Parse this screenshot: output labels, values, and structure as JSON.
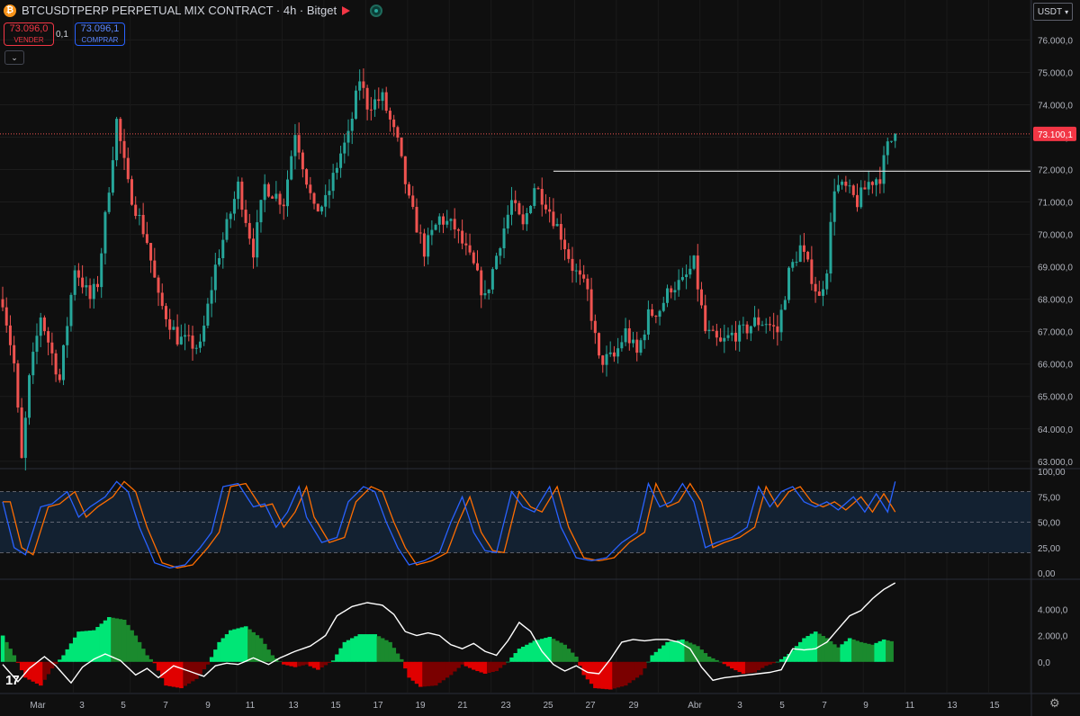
{
  "header": {
    "symbol_title": "BTCUSDTPERP PERPETUAL MIX CONTRACT · 4h · Bitget",
    "sell_price": "73.096,0",
    "sell_label": "VENDER",
    "spread": "0,1",
    "buy_price": "73.096,1",
    "buy_label": "COMPRAR",
    "currency": "USDT"
  },
  "icons": {
    "coin": "bitcoin-icon",
    "flag": "flag-icon",
    "status": "market-open-icon",
    "settings": "gear-icon"
  },
  "colors": {
    "up": "#26a69a",
    "down": "#ef5350",
    "bg": "#0f0f0f",
    "stoch_k": "#2962ff",
    "stoch_d": "#ff6d00"
  },
  "chart_data": [
    {
      "type": "candlestick",
      "price_axis": [
        "76.000,0",
        "75.000,0",
        "74.000,0",
        "73.000,0",
        "72.000,0",
        "71.000,0",
        "70.000,0",
        "69.000,0",
        "68.000,0",
        "67.000,0",
        "66.000,0",
        "65.000,0",
        "64.000,0",
        "63.000,0"
      ],
      "ylim": [
        62800,
        76400
      ],
      "last_price": 73100.1,
      "last_price_label": "73.100,1",
      "horizontal_line": 71950,
      "x_labels": [
        "Mar",
        "3",
        "5",
        "7",
        "9",
        "11",
        "13",
        "15",
        "17",
        "19",
        "21",
        "23",
        "25",
        "27",
        "29",
        "Abr",
        "3",
        "5",
        "7",
        "9",
        "11",
        "13",
        "15"
      ],
      "anchors": [
        [
          0,
          68000
        ],
        [
          3,
          66000
        ],
        [
          5,
          63000
        ],
        [
          7,
          65500
        ],
        [
          10,
          67500
        ],
        [
          15,
          65500
        ],
        [
          19,
          69000
        ],
        [
          23,
          68000
        ],
        [
          25,
          68500
        ],
        [
          30,
          73500
        ],
        [
          33,
          71500
        ],
        [
          38,
          69800
        ],
        [
          41,
          68000
        ],
        [
          46,
          66800
        ],
        [
          52,
          66500
        ],
        [
          56,
          69000
        ],
        [
          62,
          71500
        ],
        [
          66,
          69500
        ],
        [
          69,
          71500
        ],
        [
          74,
          71000
        ],
        [
          77,
          73200
        ],
        [
          82,
          70700
        ],
        [
          85,
          71000
        ],
        [
          89,
          72500
        ],
        [
          91,
          73000
        ],
        [
          94,
          74800
        ],
        [
          96,
          74000
        ],
        [
          100,
          74200
        ],
        [
          104,
          72800
        ],
        [
          107,
          71000
        ],
        [
          111,
          69500
        ],
        [
          115,
          70500
        ],
        [
          119,
          70200
        ],
        [
          124,
          69000
        ],
        [
          127,
          68000
        ],
        [
          131,
          69800
        ],
        [
          134,
          71000
        ],
        [
          137,
          70200
        ],
        [
          140,
          71500
        ],
        [
          143,
          71000
        ],
        [
          147,
          70000
        ],
        [
          150,
          69000
        ],
        [
          154,
          68200
        ],
        [
          157,
          66100
        ],
        [
          161,
          66200
        ],
        [
          164,
          67000
        ],
        [
          167,
          66300
        ],
        [
          170,
          67500
        ],
        [
          173,
          67700
        ],
        [
          176,
          68400
        ],
        [
          179,
          68500
        ],
        [
          182,
          69100
        ],
        [
          185,
          67000
        ],
        [
          189,
          66600
        ],
        [
          192,
          66900
        ],
        [
          195,
          67000
        ],
        [
          198,
          67300
        ],
        [
          201,
          67300
        ],
        [
          204,
          67000
        ],
        [
          207,
          68800
        ],
        [
          210,
          69600
        ],
        [
          213,
          68700
        ],
        [
          215,
          68000
        ],
        [
          217,
          69000
        ],
        [
          219,
          71500
        ],
        [
          222,
          71400
        ],
        [
          225,
          71000
        ],
        [
          228,
          71600
        ],
        [
          231,
          71800
        ],
        [
          233,
          72700
        ],
        [
          235,
          73100
        ]
      ]
    },
    {
      "type": "line",
      "name": "stochastic",
      "axis": [
        "100,00",
        "75,00",
        "50,00",
        "25,00",
        "0,00"
      ],
      "band": [
        20,
        80
      ],
      "mid": 50,
      "k": [
        [
          0,
          70
        ],
        [
          3,
          25
        ],
        [
          6,
          18
        ],
        [
          10,
          65
        ],
        [
          13,
          68
        ],
        [
          17,
          80
        ],
        [
          20,
          55
        ],
        [
          23,
          65
        ],
        [
          27,
          75
        ],
        [
          30,
          90
        ],
        [
          33,
          80
        ],
        [
          36,
          45
        ],
        [
          40,
          10
        ],
        [
          44,
          5
        ],
        [
          48,
          8
        ],
        [
          52,
          25
        ],
        [
          55,
          40
        ],
        [
          58,
          85
        ],
        [
          62,
          88
        ],
        [
          66,
          65
        ],
        [
          69,
          68
        ],
        [
          72,
          45
        ],
        [
          75,
          60
        ],
        [
          78,
          85
        ],
        [
          80,
          55
        ],
        [
          84,
          30
        ],
        [
          88,
          35
        ],
        [
          91,
          70
        ],
        [
          95,
          85
        ],
        [
          98,
          80
        ],
        [
          101,
          50
        ],
        [
          104,
          25
        ],
        [
          107,
          8
        ],
        [
          111,
          12
        ],
        [
          115,
          20
        ],
        [
          118,
          50
        ],
        [
          121,
          75
        ],
        [
          124,
          40
        ],
        [
          127,
          22
        ],
        [
          130,
          20
        ],
        [
          134,
          80
        ],
        [
          137,
          65
        ],
        [
          140,
          60
        ],
        [
          144,
          85
        ],
        [
          147,
          45
        ],
        [
          151,
          15
        ],
        [
          155,
          12
        ],
        [
          159,
          15
        ],
        [
          163,
          30
        ],
        [
          167,
          40
        ],
        [
          170,
          88
        ],
        [
          173,
          65
        ],
        [
          176,
          70
        ],
        [
          179,
          88
        ],
        [
          182,
          70
        ],
        [
          185,
          25
        ],
        [
          188,
          30
        ],
        [
          192,
          35
        ],
        [
          196,
          45
        ],
        [
          199,
          85
        ],
        [
          202,
          65
        ],
        [
          205,
          80
        ],
        [
          208,
          85
        ],
        [
          211,
          70
        ],
        [
          214,
          65
        ],
        [
          217,
          70
        ],
        [
          220,
          62
        ],
        [
          224,
          75
        ],
        [
          227,
          60
        ],
        [
          230,
          78
        ],
        [
          233,
          60
        ],
        [
          235,
          90
        ]
      ],
      "d_lag": 2
    },
    {
      "type": "area",
      "name": "squeeze-momentum",
      "axis": [
        "4.000,0",
        "2.000,0",
        "0,0"
      ],
      "ylim": [
        -2200,
        6000
      ],
      "momentum": [
        [
          0,
          2000
        ],
        [
          3,
          500
        ],
        [
          6,
          -1200
        ],
        [
          10,
          -1800
        ],
        [
          13,
          -500
        ],
        [
          16,
          500
        ],
        [
          20,
          2300
        ],
        [
          24,
          2400
        ],
        [
          28,
          3400
        ],
        [
          32,
          3200
        ],
        [
          35,
          2000
        ],
        [
          38,
          500
        ],
        [
          40,
          -100
        ],
        [
          43,
          -1800
        ],
        [
          47,
          -2000
        ],
        [
          51,
          -1300
        ],
        [
          54,
          -200
        ],
        [
          57,
          1500
        ],
        [
          60,
          2400
        ],
        [
          64,
          2700
        ],
        [
          68,
          1800
        ],
        [
          71,
          500
        ],
        [
          74,
          -200
        ],
        [
          77,
          -400
        ],
        [
          80,
          -200
        ],
        [
          83,
          -600
        ],
        [
          87,
          100
        ],
        [
          90,
          1500
        ],
        [
          94,
          2100
        ],
        [
          98,
          2100
        ],
        [
          102,
          1500
        ],
        [
          105,
          200
        ],
        [
          107,
          -1200
        ],
        [
          110,
          -1900
        ],
        [
          114,
          -1800
        ],
        [
          118,
          -1000
        ],
        [
          121,
          -200
        ],
        [
          124,
          -600
        ],
        [
          127,
          -900
        ],
        [
          130,
          -700
        ],
        [
          133,
          0
        ],
        [
          136,
          1000
        ],
        [
          140,
          1600
        ],
        [
          144,
          1900
        ],
        [
          148,
          1300
        ],
        [
          151,
          400
        ],
        [
          153,
          -1000
        ],
        [
          156,
          -2000
        ],
        [
          160,
          -2100
        ],
        [
          164,
          -1800
        ],
        [
          168,
          -1000
        ],
        [
          171,
          500
        ],
        [
          175,
          1500
        ],
        [
          179,
          1700
        ],
        [
          183,
          1200
        ],
        [
          186,
          400
        ],
        [
          189,
          0
        ],
        [
          192,
          -500
        ],
        [
          195,
          -900
        ],
        [
          198,
          -800
        ],
        [
          201,
          -300
        ],
        [
          204,
          0
        ],
        [
          207,
          600
        ],
        [
          211,
          1800
        ],
        [
          214,
          2300
        ],
        [
          217,
          1800
        ],
        [
          220,
          1100
        ],
        [
          223,
          1800
        ],
        [
          226,
          1500
        ],
        [
          229,
          1300
        ],
        [
          232,
          1700
        ],
        [
          235,
          1500
        ]
      ],
      "line": [
        [
          0,
          -200
        ],
        [
          4,
          -1500
        ],
        [
          7,
          -500
        ],
        [
          11,
          400
        ],
        [
          14,
          -300
        ],
        [
          18,
          -1600
        ],
        [
          21,
          -400
        ],
        [
          24,
          200
        ],
        [
          27,
          600
        ],
        [
          31,
          100
        ],
        [
          35,
          -1000
        ],
        [
          38,
          -500
        ],
        [
          41,
          -1200
        ],
        [
          45,
          -300
        ],
        [
          49,
          -700
        ],
        [
          53,
          -1100
        ],
        [
          56,
          -300
        ],
        [
          59,
          -100
        ],
        [
          62,
          -200
        ],
        [
          66,
          300
        ],
        [
          70,
          -200
        ],
        [
          73,
          300
        ],
        [
          77,
          800
        ],
        [
          81,
          1200
        ],
        [
          85,
          2000
        ],
        [
          88,
          3500
        ],
        [
          92,
          4200
        ],
        [
          96,
          4500
        ],
        [
          100,
          4300
        ],
        [
          103,
          3600
        ],
        [
          106,
          2300
        ],
        [
          109,
          2000
        ],
        [
          112,
          2200
        ],
        [
          115,
          2000
        ],
        [
          118,
          1300
        ],
        [
          121,
          1000
        ],
        [
          124,
          1400
        ],
        [
          127,
          800
        ],
        [
          130,
          500
        ],
        [
          133,
          1600
        ],
        [
          136,
          3000
        ],
        [
          139,
          2300
        ],
        [
          142,
          800
        ],
        [
          145,
          -200
        ],
        [
          148,
          -700
        ],
        [
          151,
          -300
        ],
        [
          154,
          -800
        ],
        [
          157,
          -900
        ],
        [
          160,
          200
        ],
        [
          163,
          1500
        ],
        [
          166,
          1700
        ],
        [
          169,
          1600
        ],
        [
          172,
          1700
        ],
        [
          175,
          1700
        ],
        [
          178,
          1500
        ],
        [
          181,
          1000
        ],
        [
          184,
          -400
        ],
        [
          187,
          -1400
        ],
        [
          190,
          -1200
        ],
        [
          193,
          -1100
        ],
        [
          196,
          -1000
        ],
        [
          199,
          -900
        ],
        [
          202,
          -800
        ],
        [
          205,
          -600
        ],
        [
          208,
          1000
        ],
        [
          211,
          900
        ],
        [
          214,
          1000
        ],
        [
          217,
          1500
        ],
        [
          220,
          2500
        ],
        [
          223,
          3500
        ],
        [
          226,
          3900
        ],
        [
          229,
          4800
        ],
        [
          232,
          5500
        ],
        [
          235,
          6000
        ]
      ]
    }
  ]
}
